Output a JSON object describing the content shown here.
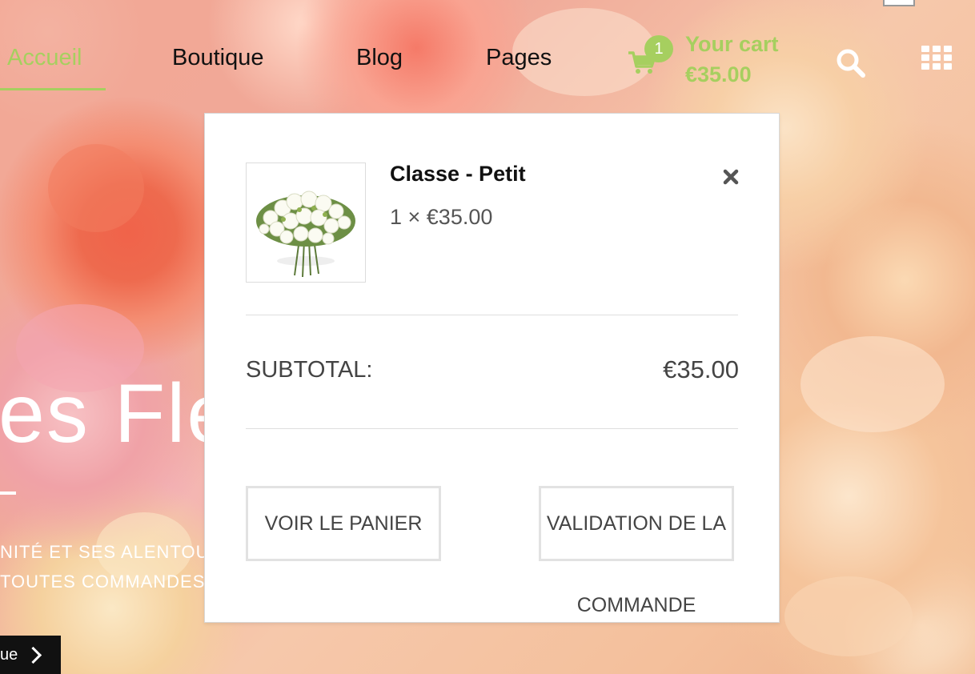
{
  "nav": {
    "items": [
      {
        "label": "Accueil",
        "active": true
      },
      {
        "label": "Boutique",
        "active": false
      },
      {
        "label": "Blog",
        "active": false
      },
      {
        "label": "Pages",
        "active": false
      }
    ],
    "accent_color": "#a6cf5f"
  },
  "cart": {
    "count": "1",
    "title": "Your cart",
    "total": "€35.00",
    "icons": [
      "cart-icon",
      "search-icon",
      "grid-menu-icon"
    ]
  },
  "hero": {
    "title_fragment": "es Fle",
    "line1": "NITÉ ET SES ALENTOUR",
    "line2": "TOUTES COMMANDES",
    "button_fragment": "ue"
  },
  "minicart": {
    "item": {
      "name": "Classe - Petit",
      "quantity_price": "1 × €35.00"
    },
    "subtotal_label": "SUBTOTAL:",
    "subtotal_value": "€35.00",
    "view_cart_label": "VOIR LE PANIER",
    "checkout_label_line1": "VALIDATION DE LA",
    "checkout_label_line2": "COMMANDE"
  }
}
